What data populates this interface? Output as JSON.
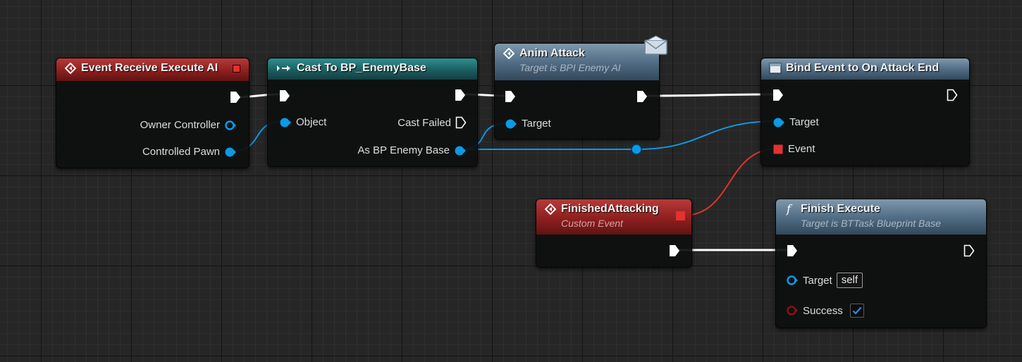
{
  "nodes": {
    "event_receive_execute_ai": {
      "title": "Event Receive Execute AI",
      "pins": {
        "owner_controller": "Owner Controller",
        "controlled_pawn": "Controlled Pawn"
      }
    },
    "cast_to_bp_enemybase": {
      "title": "Cast To BP_EnemyBase",
      "pins": {
        "object": "Object",
        "cast_failed": "Cast Failed",
        "as_bp_enemy_base": "As BP Enemy Base"
      }
    },
    "anim_attack": {
      "title": "Anim Attack",
      "subtitle": "Target is BPI Enemy AI",
      "pins": {
        "target": "Target"
      }
    },
    "bind_event": {
      "title": "Bind Event to On Attack End",
      "pins": {
        "target": "Target",
        "event": "Event"
      }
    },
    "finished_attacking": {
      "title": "FinishedAttacking",
      "subtitle": "Custom Event"
    },
    "finish_execute": {
      "title": "Finish Execute",
      "subtitle": "Target is BTTask Blueprint Base",
      "pins": {
        "target": "Target",
        "target_default": "self",
        "success": "Success",
        "success_checked": true
      }
    }
  },
  "colors": {
    "exec_pin": "#ffffff",
    "object_pin": "#0a9ae6",
    "delegate_pin": "#e43131",
    "bool_pin": "#8c1010",
    "event_header": "#8a1d1d",
    "pure_cast_header": "#1c5e60",
    "function_header": "#4e6a82",
    "grid_background": "#262626"
  },
  "icons": {
    "event": "event-diamond-icon",
    "cast": "cast-arrow-icon",
    "function": "function-f-icon",
    "bind": "bind-event-icon",
    "message": "envelope-message-icon"
  }
}
